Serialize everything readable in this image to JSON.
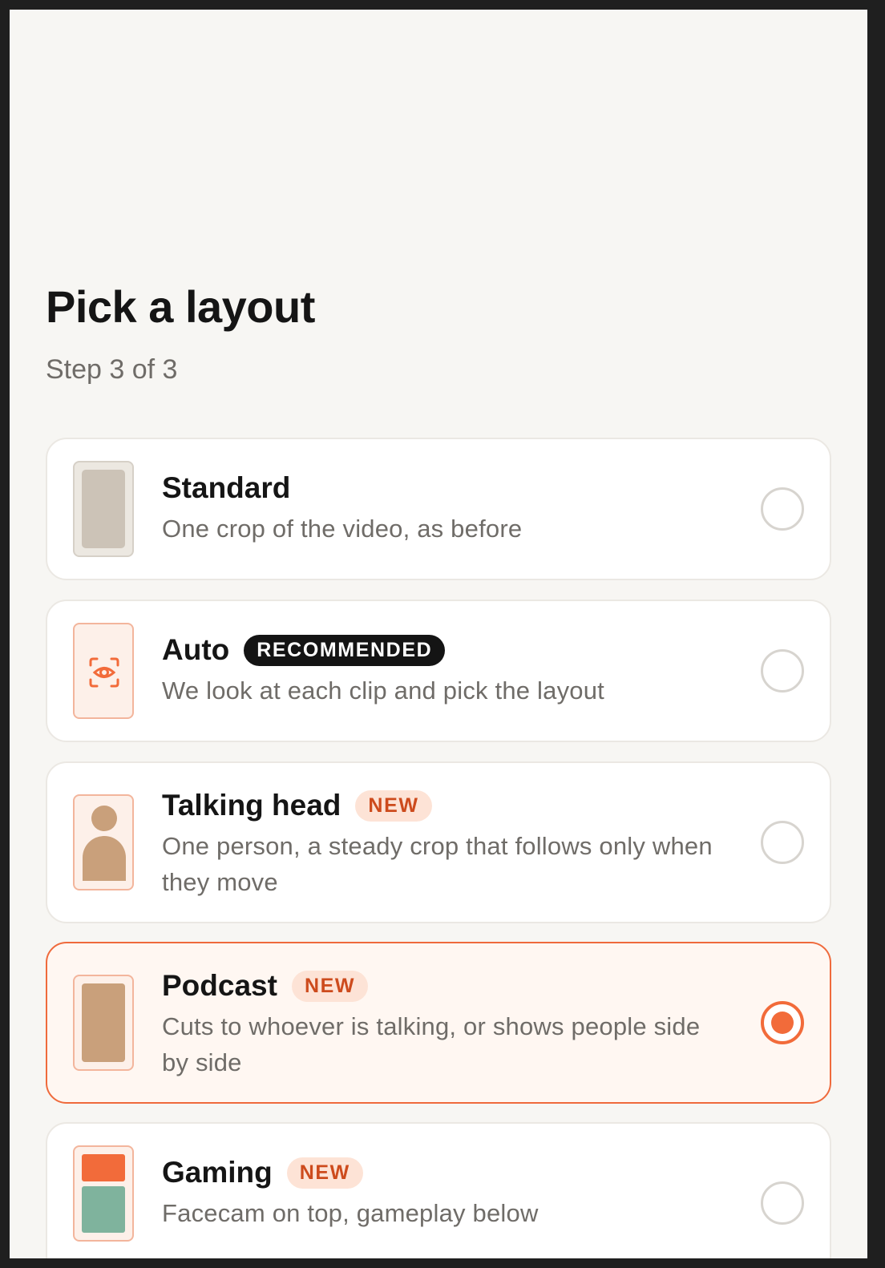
{
  "header": {
    "title": "Pick a layout",
    "step": "Step 3 of 3"
  },
  "options": [
    {
      "title": "Standard",
      "description": "One crop of the video, as before",
      "badge": "",
      "selected": false,
      "icon": "portrait-frame-icon"
    },
    {
      "title": "Auto",
      "description": "We look at each clip and pick the layout",
      "badge": "RECOMMENDED",
      "selected": false,
      "icon": "eye-scan-icon"
    },
    {
      "title": "Talking head",
      "description": "One person, a steady crop that follows only when they move",
      "badge": "NEW",
      "selected": false,
      "icon": "person-icon"
    },
    {
      "title": "Podcast",
      "description": "Cuts to whoever is talking, or shows people side by side",
      "badge": "NEW",
      "selected": true,
      "icon": "podcast-frame-icon"
    },
    {
      "title": "Gaming",
      "description": "Facecam on top, gameplay below",
      "badge": "NEW",
      "selected": false,
      "icon": "split-screen-icon"
    }
  ],
  "colors": {
    "accent": "#f26b3a",
    "background": "#f7f6f3",
    "badge_new_bg": "#fde3d6",
    "badge_new_text": "#cd4b1d",
    "badge_recommended_bg": "#141414"
  }
}
